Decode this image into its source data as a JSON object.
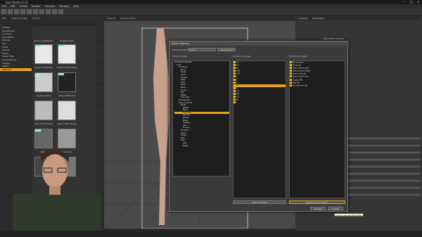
{
  "app": {
    "title": "Daz Studio 4.12"
  },
  "menu": [
    "File",
    "Edit",
    "Create",
    "Render",
    "Connect",
    "Window",
    "Help"
  ],
  "left_tabs": [
    "Files",
    "Smart Content",
    "Product"
  ],
  "categories": [
    "All Files",
    "Accessories",
    "Anatomy",
    "Animations",
    "Figures",
    "Hair",
    "Props",
    "Scenes",
    "Poses",
    "Saved Files",
    "Scene Builder",
    "Shaping",
    "Lights",
    "Materials"
  ],
  "selected_category": "Materials",
  "thumbnails": [
    {
      "name": "Granny Nightgown",
      "badge": "Saved"
    },
    {
      "name": "Lingerie Robe",
      "badge": "Saved"
    },
    {
      "name": "Lingerie Robe Bra",
      "badge": "Saved"
    },
    {
      "name": "Lingerie Robe Panty",
      "badge": "Saved"
    },
    {
      "name": "Lingerie Robe",
      "badge": "Saved"
    },
    {
      "name": "Robe Outfit Full",
      "badge": "Saved"
    },
    {
      "name": "Robe Outfit Boots",
      "badge": "Saved"
    },
    {
      "name": "Robe Outfit Shoes",
      "badge": "Saved"
    },
    {
      "name": "Rob...",
      "badge": "Saved"
    },
    {
      "name": "Dart Lord",
      "badge": "Saved"
    }
  ],
  "viewport_tabs": [
    "Viewport",
    "Render Library"
  ],
  "dialog": {
    "title": "Select Morphs",
    "choose_preset_label": "Choose Preset",
    "preset_value": "None",
    "save_preset": "Save Preset",
    "morph_groups_label": "Morph Groups",
    "morphs_in_group_label": "Morphs in Group",
    "morphs_to_export_label": "Morphs to Export",
    "tree": [
      "Genesis 8 Female",
      "Actor",
      "Full Body",
      "Body",
      "Head",
      "Arms",
      "Hands",
      "Legs",
      "Feet",
      "Torso",
      "Neck",
      "Chest",
      "Hip",
      "Waist",
      "Shoulder",
      "Expressions",
      "Pose Controls",
      "Head",
      "Mouth",
      "Eyes",
      "Visemes",
      "Eyelids",
      "Brows",
      "Nose",
      "Cheeks",
      "Jaw",
      "Tongue",
      "Forearm",
      "Hand",
      "Thigh",
      "Shin",
      "Foot",
      "Left",
      "Right"
    ],
    "tree_selected": "Visemes",
    "group_morphs": [
      "AA",
      "EE",
      "IH",
      "OW",
      "UW",
      "F",
      "K",
      "L",
      "M",
      "S",
      "CH",
      "ER",
      "TH",
      "W",
      "Y"
    ],
    "group_selected": "M",
    "export_morphs": [
      "Brow Down",
      "Brow Up",
      "Eyes Closed Left",
      "Eyes Closed Right",
      "Eyes Look Up",
      "Eyes Look Down",
      "Happy HD",
      "Sad HD",
      "Excitement HD"
    ],
    "add_button": "Add for Export",
    "remove_button": "Remove From Export",
    "accept": "Accept",
    "cancel": "Cancel"
  },
  "right_panel": {
    "tabs": [
      "Surfaces",
      "Parameters"
    ],
    "title": "Parameter Settings"
  },
  "tooltip": "Click to execute this action"
}
